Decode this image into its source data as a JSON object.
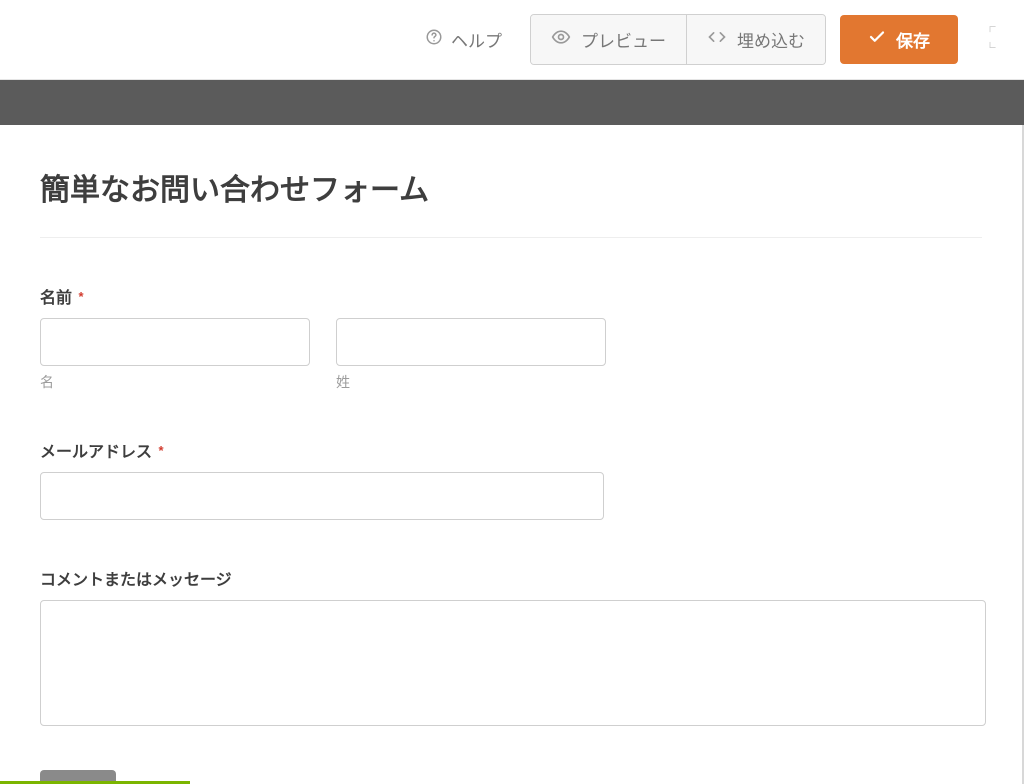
{
  "toolbar": {
    "help_label": "ヘルプ",
    "preview_label": "プレビュー",
    "embed_label": "埋め込む",
    "save_label": "保存"
  },
  "form": {
    "title": "簡単なお問い合わせフォーム",
    "fields": {
      "name": {
        "label": "名前",
        "required": true,
        "sublabels": {
          "first": "名",
          "last": "姓"
        },
        "first_value": "",
        "last_value": ""
      },
      "email": {
        "label": "メールアドレス",
        "required": true,
        "value": ""
      },
      "message": {
        "label": "コメントまたはメッセージ",
        "required": false,
        "value": ""
      }
    },
    "required_mark": "*"
  },
  "colors": {
    "accent": "#e27730",
    "progress": "#7bb500"
  }
}
